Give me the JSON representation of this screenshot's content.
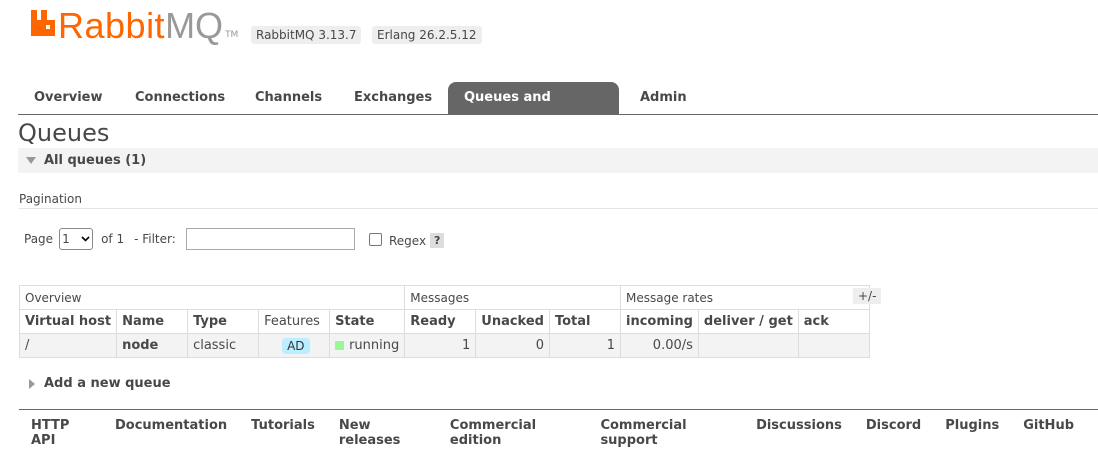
{
  "header": {
    "logo_rabbit": "Rabbit",
    "logo_mq": "MQ",
    "logo_tm": "TM",
    "rabbitmq_version": "RabbitMQ 3.13.7",
    "erlang_version": "Erlang 26.2.5.12",
    "brand_color": "#ff6600"
  },
  "tabs": [
    {
      "label": "Overview",
      "active": false
    },
    {
      "label": "Connections",
      "active": false
    },
    {
      "label": "Channels",
      "active": false
    },
    {
      "label": "Exchanges",
      "active": false
    },
    {
      "label": "Queues and Streams",
      "active": true
    },
    {
      "label": "Admin",
      "active": false
    }
  ],
  "main": {
    "title": "Queues",
    "section_title": "All queues (1)",
    "pagination_label": "Pagination",
    "page_label": "Page",
    "page_value": "1",
    "of_label": "of 1",
    "filter_label": "- Filter:",
    "filter_value": "",
    "regex_label": "Regex",
    "help_label": "?",
    "columns_toggle": "+/-",
    "add_queue_label": "Add a new queue"
  },
  "table": {
    "groups": [
      "Overview",
      "Messages",
      "Message rates"
    ],
    "columns": [
      "Virtual host",
      "Name",
      "Type",
      "Features",
      "State",
      "Ready",
      "Unacked",
      "Total",
      "incoming",
      "deliver / get",
      "ack"
    ],
    "rows": [
      {
        "vhost": "/",
        "name": "node",
        "type": "classic",
        "features": "AD",
        "state": "running",
        "ready": "1",
        "unacked": "0",
        "total": "1",
        "incoming": "0.00/s",
        "deliver_get": "",
        "ack": ""
      }
    ]
  },
  "footer": {
    "links": [
      "HTTP API",
      "Documentation",
      "Tutorials",
      "New releases",
      "Commercial edition",
      "Commercial support",
      "Discussions",
      "Discord",
      "Plugins",
      "GitHub"
    ]
  }
}
